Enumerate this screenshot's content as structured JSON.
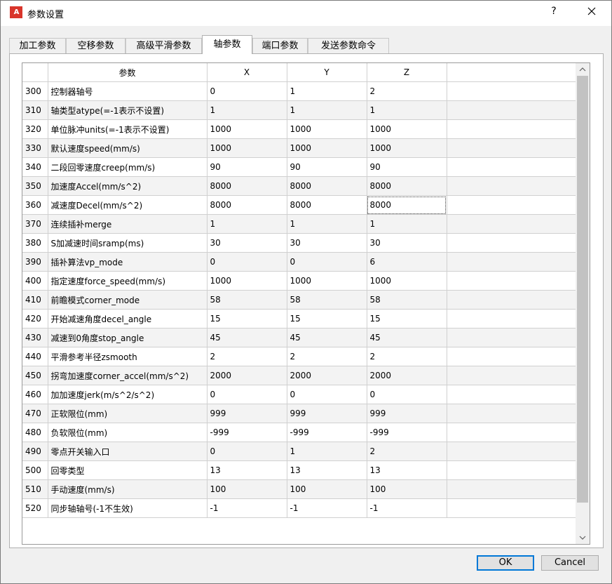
{
  "window": {
    "icon_text": "A",
    "title": "参数设置",
    "help_label": "?"
  },
  "tabs": [
    {
      "label": "加工参数",
      "active": false
    },
    {
      "label": "空移参数",
      "active": false
    },
    {
      "label": "高级平滑参数",
      "active": false
    },
    {
      "label": "轴参数",
      "active": true
    },
    {
      "label": "端口参数",
      "active": false
    },
    {
      "label": "发送参数命令",
      "active": false
    }
  ],
  "table": {
    "headers": [
      "",
      "参数",
      "X",
      "Y",
      "Z",
      ""
    ],
    "rows": [
      {
        "id": "300",
        "name": "控制器轴号",
        "x": "0",
        "y": "1",
        "z": "2"
      },
      {
        "id": "310",
        "name": "轴类型atype(=-1表示不设置)",
        "x": "1",
        "y": "1",
        "z": "1"
      },
      {
        "id": "320",
        "name": "单位脉冲units(=-1表示不设置)",
        "x": "1000",
        "y": "1000",
        "z": "1000"
      },
      {
        "id": "330",
        "name": "默认速度speed(mm/s)",
        "x": "1000",
        "y": "1000",
        "z": "1000"
      },
      {
        "id": "340",
        "name": "二段回零速度creep(mm/s)",
        "x": "90",
        "y": "90",
        "z": "90"
      },
      {
        "id": "350",
        "name": "加速度Accel(mm/s^2)",
        "x": "8000",
        "y": "8000",
        "z": "8000"
      },
      {
        "id": "360",
        "name": "减速度Decel(mm/s^2)",
        "x": "8000",
        "y": "8000",
        "z": "8000"
      },
      {
        "id": "370",
        "name": "连续插补merge",
        "x": "1",
        "y": "1",
        "z": "1"
      },
      {
        "id": "380",
        "name": "S加减速时间sramp(ms)",
        "x": "30",
        "y": "30",
        "z": "30"
      },
      {
        "id": "390",
        "name": "插补算法vp_mode",
        "x": "0",
        "y": "0",
        "z": "6"
      },
      {
        "id": "400",
        "name": "指定速度force_speed(mm/s)",
        "x": "1000",
        "y": "1000",
        "z": "1000"
      },
      {
        "id": "410",
        "name": "前瞻模式corner_mode",
        "x": "58",
        "y": "58",
        "z": "58"
      },
      {
        "id": "420",
        "name": "开始减速角度decel_angle",
        "x": "15",
        "y": "15",
        "z": "15"
      },
      {
        "id": "430",
        "name": "减速到0角度stop_angle",
        "x": "45",
        "y": "45",
        "z": "45"
      },
      {
        "id": "440",
        "name": "平滑参考半径zsmooth",
        "x": "2",
        "y": "2",
        "z": "2"
      },
      {
        "id": "450",
        "name": "拐弯加速度corner_accel(mm/s^2)",
        "x": "2000",
        "y": "2000",
        "z": "2000"
      },
      {
        "id": "460",
        "name": "加加速度jerk(m/s^2/s^2)",
        "x": "0",
        "y": "0",
        "z": "0"
      },
      {
        "id": "470",
        "name": "正软限位(mm)",
        "x": "999",
        "y": "999",
        "z": "999"
      },
      {
        "id": "480",
        "name": "负软限位(mm)",
        "x": "-999",
        "y": "-999",
        "z": "-999"
      },
      {
        "id": "490",
        "name": "零点开关输入口",
        "x": "0",
        "y": "1",
        "z": "2"
      },
      {
        "id": "500",
        "name": "回零类型",
        "x": "13",
        "y": "13",
        "z": "13"
      },
      {
        "id": "510",
        "name": "手动速度(mm/s)",
        "x": "100",
        "y": "100",
        "z": "100"
      },
      {
        "id": "520",
        "name": "同步轴轴号(-1不生效)",
        "x": "-1",
        "y": "-1",
        "z": "-1"
      }
    ],
    "focused_cell": {
      "row": 6,
      "col": "z"
    }
  },
  "buttons": {
    "ok_label": "OK",
    "cancel_label": "Cancel"
  },
  "icons": {
    "close": "close-icon",
    "scroll_up": "chevron-up-icon",
    "scroll_down": "chevron-down-icon"
  }
}
